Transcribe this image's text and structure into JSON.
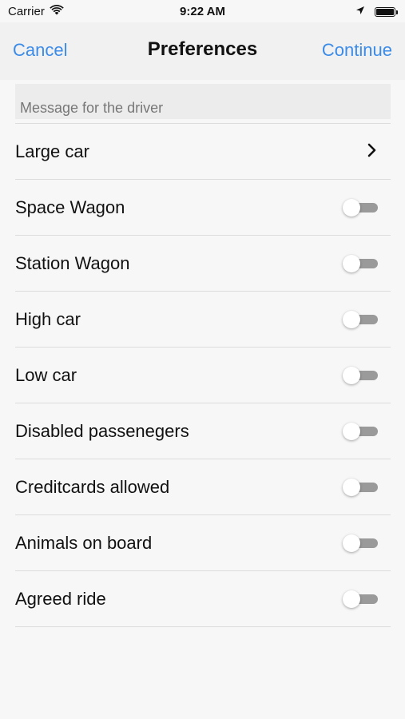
{
  "status_bar": {
    "carrier": "Carrier",
    "time": "9:22 AM"
  },
  "nav": {
    "cancel": "Cancel",
    "title": "Preferences",
    "continue": "Continue"
  },
  "message": {
    "placeholder": "Message for the driver"
  },
  "rows": [
    {
      "label": "Large car",
      "kind": "disclosure"
    },
    {
      "label": "Space Wagon",
      "kind": "toggle",
      "on": false
    },
    {
      "label": "Station Wagon",
      "kind": "toggle",
      "on": false
    },
    {
      "label": "High car",
      "kind": "toggle",
      "on": false
    },
    {
      "label": "Low car",
      "kind": "toggle",
      "on": false
    },
    {
      "label": "Disabled passenegers",
      "kind": "toggle",
      "on": false
    },
    {
      "label": "Creditcards allowed",
      "kind": "toggle",
      "on": false
    },
    {
      "label": "Animals on board",
      "kind": "toggle",
      "on": false
    },
    {
      "label": "Agreed ride",
      "kind": "toggle",
      "on": false
    }
  ],
  "colors": {
    "accent": "#3b8be8",
    "toggle_off": "#9a9a9a"
  },
  "icons": {
    "wifi": "wifi-icon",
    "location": "location-arrow-icon",
    "battery": "battery-icon",
    "chevron": "chevron-right-icon"
  }
}
